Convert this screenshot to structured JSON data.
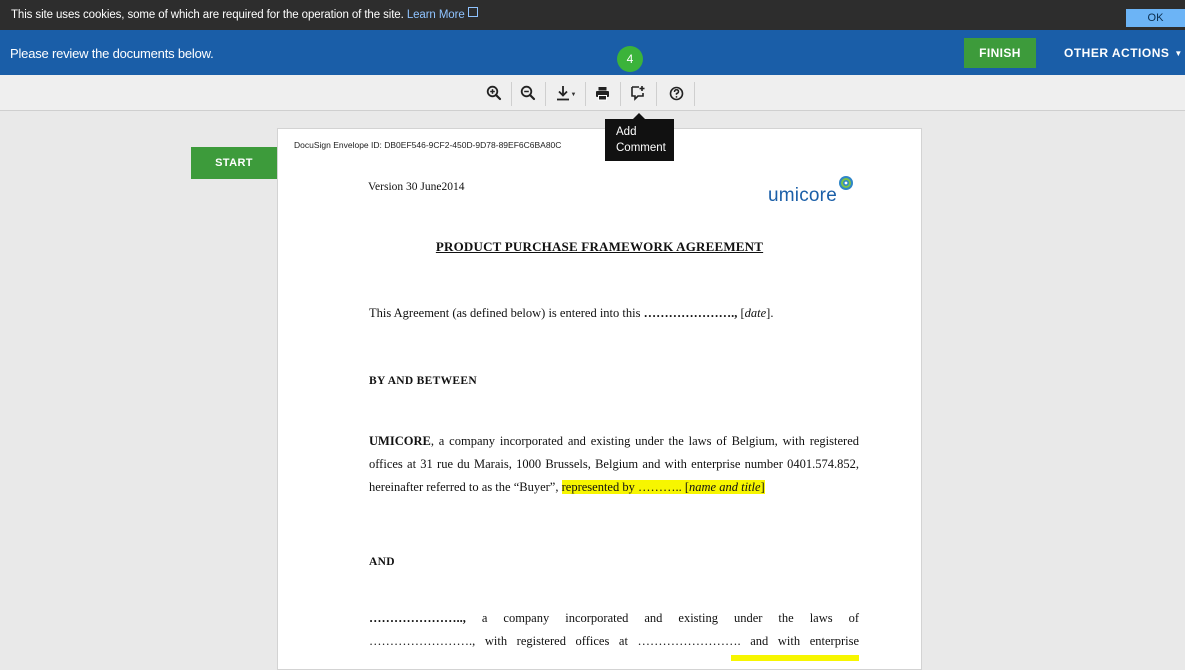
{
  "cookie_bar": {
    "text": "This site uses cookies, some of which are required for the operation of the site.",
    "link": "Learn More",
    "ok_label": "OK"
  },
  "header": {
    "review_text": "Please review the documents below.",
    "step_count": "4",
    "finish_label": "FINISH",
    "other_actions_label": "OTHER ACTIONS"
  },
  "toolbar": {
    "tooltip_line1": "Add",
    "tooltip_line2": "Comment",
    "icons": [
      "zoom-in-icon",
      "zoom-out-icon",
      "download-icon",
      "print-icon",
      "add-comment-icon",
      "help-icon"
    ]
  },
  "start_label": "START",
  "document": {
    "envelope_id": "DocuSign Envelope ID: DB0EF546-9CF2-450D-9D78-89EF6C6BA80C",
    "version": "Version 30 June2014",
    "logo": "umicore",
    "title": "PRODUCT PURCHASE FRAMEWORK AGREEMENT",
    "intro_prefix": "This Agreement (as defined below) is entered into this",
    "intro_dots": "………………….,",
    "intro_date": "date",
    "by_and_between": "By and Between",
    "umicore_name": "UMICORE",
    "umicore_line1_rest": ", a company incorporated and existing under the laws of Belgium, with registered",
    "umicore_line2": "offices at 31 rue du Marais, 1000 Brussels, Belgium and with enterprise number 0401.574.852,",
    "umicore_line3_prefix": "hereinafter referred to as the “Buyer”,",
    "represented_by": "represented by ……….. [",
    "name_and_title": "name and title",
    "bracket_close": "]",
    "and": "And",
    "party_line1_dots": "…………………..,",
    "party_line1_rest": "a company incorporated and existing under the laws of",
    "party_line2": "……………………., with registered offices at ……………………. and with enterprise"
  }
}
